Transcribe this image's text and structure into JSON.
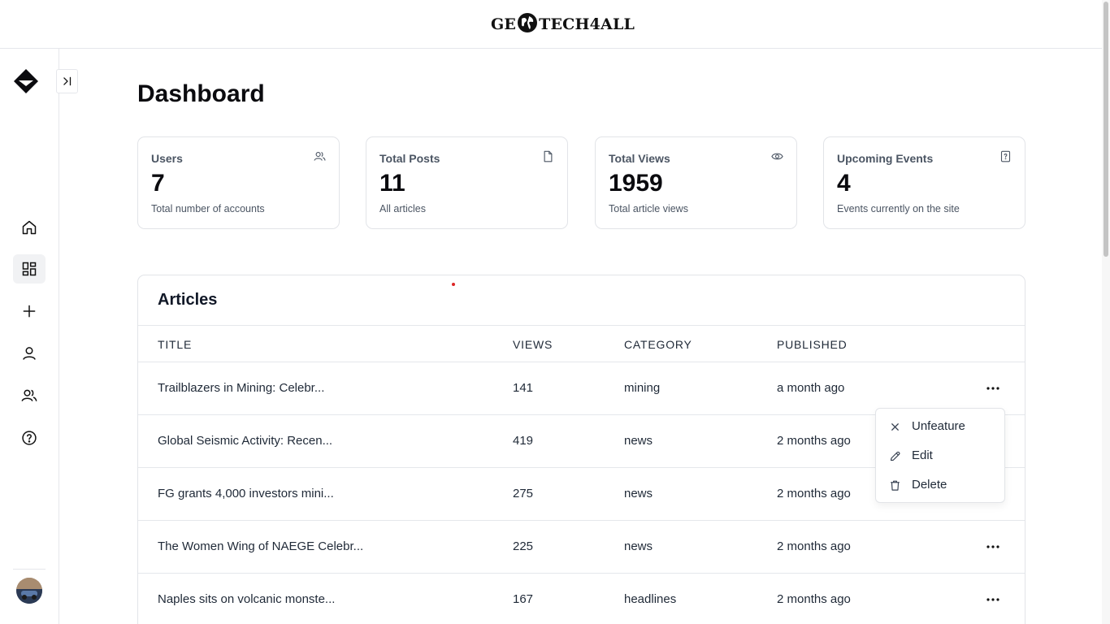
{
  "header": {
    "logo_left": "GE",
    "logo_right": "TECH4ALL"
  },
  "sidebar": {
    "items": [
      {
        "icon": "home-icon",
        "active": false
      },
      {
        "icon": "dashboard-grid-icon",
        "active": true
      },
      {
        "icon": "plus-icon",
        "active": false
      },
      {
        "icon": "user-icon",
        "active": false
      },
      {
        "icon": "users-icon",
        "active": false
      },
      {
        "icon": "help-circle-icon",
        "active": false
      }
    ]
  },
  "main": {
    "title": "Dashboard",
    "cards": [
      {
        "label": "Users",
        "value": "7",
        "sub": "Total number of accounts",
        "icon": "users-icon"
      },
      {
        "label": "Total Posts",
        "value": "11",
        "sub": "All articles",
        "icon": "file-icon"
      },
      {
        "label": "Total Views",
        "value": "1959",
        "sub": "Total article views",
        "icon": "eye-icon"
      },
      {
        "label": "Upcoming Events",
        "value": "4",
        "sub": "Events currently on the site",
        "icon": "question-file-icon"
      }
    ],
    "articles": {
      "title": "Articles",
      "columns": [
        "TITLE",
        "VIEWS",
        "CATEGORY",
        "PUBLISHED"
      ],
      "rows": [
        {
          "title": "Trailblazers in Mining: Celebr...",
          "views": "141",
          "category": "mining",
          "published": "a month ago"
        },
        {
          "title": "Global Seismic Activity: Recen...",
          "views": "419",
          "category": "news",
          "published": "2 months ago"
        },
        {
          "title": "FG grants 4,000 investors mini...",
          "views": "275",
          "category": "news",
          "published": "2 months ago"
        },
        {
          "title": "The Women Wing of NAEGE Celebr...",
          "views": "225",
          "category": "news",
          "published": "2 months ago"
        },
        {
          "title": "Naples sits on volcanic monste...",
          "views": "167",
          "category": "headlines",
          "published": "2 months ago"
        }
      ]
    },
    "row_menu": {
      "items": [
        {
          "label": "Unfeature",
          "icon": "close-icon"
        },
        {
          "label": "Edit",
          "icon": "pencil-icon"
        },
        {
          "label": "Delete",
          "icon": "trash-icon"
        }
      ]
    }
  },
  "colors": {
    "text": "#111827",
    "muted": "#4b5563",
    "border": "#e2e4e8",
    "active_bg": "#f1f2f4"
  }
}
